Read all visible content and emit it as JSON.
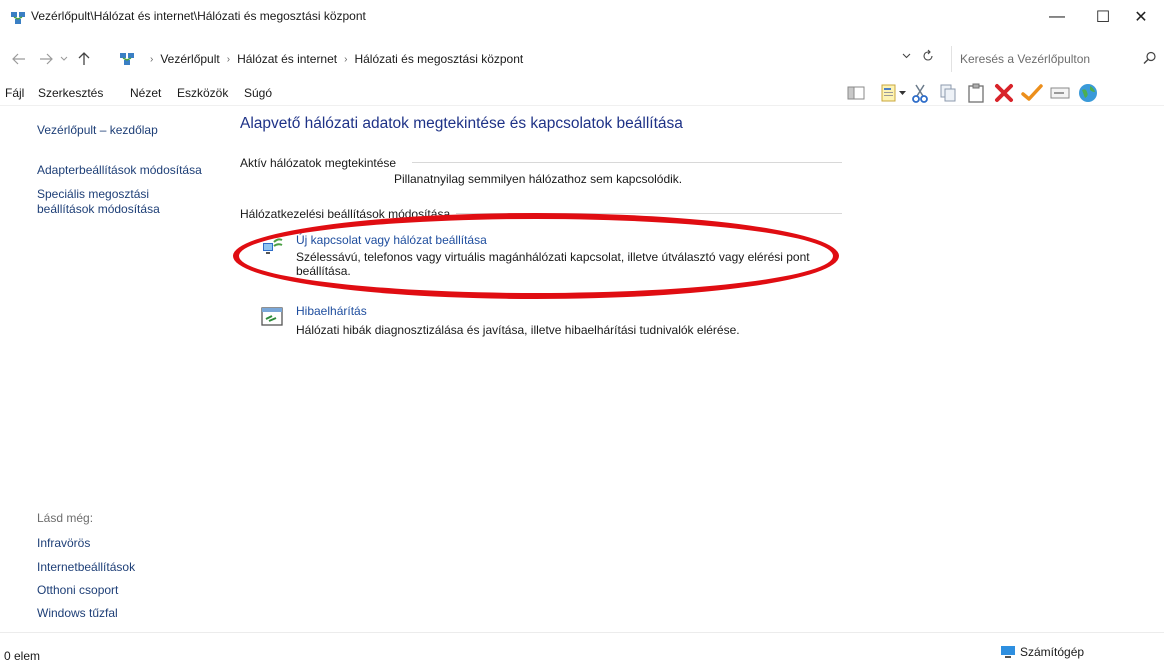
{
  "window": {
    "title": "Vezérlőpult\\Hálózat és internet\\Hálózati és megosztási központ",
    "controls": {
      "minimize": "—",
      "maximize": "☐",
      "close": "✕"
    }
  },
  "address": {
    "crumbs": [
      "Vezérlőpult",
      "Hálózat és internet",
      "Hálózati és megosztási központ"
    ],
    "search_placeholder": "Keresés a Vezérlőpulton"
  },
  "menu": {
    "file": "Fájl",
    "edit": "Szerkesztés",
    "view": "Nézet",
    "tools": "Eszközök",
    "help": "Súgó"
  },
  "toolbar": {
    "icons": [
      "layout-icon",
      "properties-icon",
      "cut-icon",
      "copy-icon",
      "paste-icon",
      "delete-icon",
      "undo-icon",
      "rename-icon",
      "globe-icon"
    ]
  },
  "sidebar": {
    "home": "Vezérlőpult – kezdőlap",
    "links": [
      "Adapterbeállítások módosítása",
      "Speciális megosztási",
      "beállítások módosítása"
    ],
    "see_also_label": "Lásd még:",
    "see_also": [
      "Infravörös",
      "Internetbeállítások",
      "Otthoni csoport",
      "Windows tűzfal"
    ]
  },
  "main": {
    "title": "Alapvető hálózati adatok megtekintése és kapcsolatok beállítása",
    "active_networks_header": "Aktív hálózatok megtekintése",
    "no_network_text": "Pillanatnyilag semmilyen hálózathoz sem kapcsolódik.",
    "settings_header": "Hálózatkezelési beállítások módosítása",
    "tasks": [
      {
        "link": "Új kapcsolat vagy hálózat beállítása",
        "desc": "Szélessávú, telefonos vagy virtuális magánhálózati kapcsolat, illetve útválasztó vagy elérési pont beállítása."
      },
      {
        "link": "Hibaelhárítás",
        "desc": "Hálózati hibák diagnosztizálása és javítása, illetve hibaelhárítási tudnivalók elérése."
      }
    ]
  },
  "status": {
    "count": "0 elem",
    "zone": "Számítógép"
  },
  "colors": {
    "link": "#1e3f77",
    "title": "#1e3287",
    "annotation_red": "#e00d12"
  }
}
